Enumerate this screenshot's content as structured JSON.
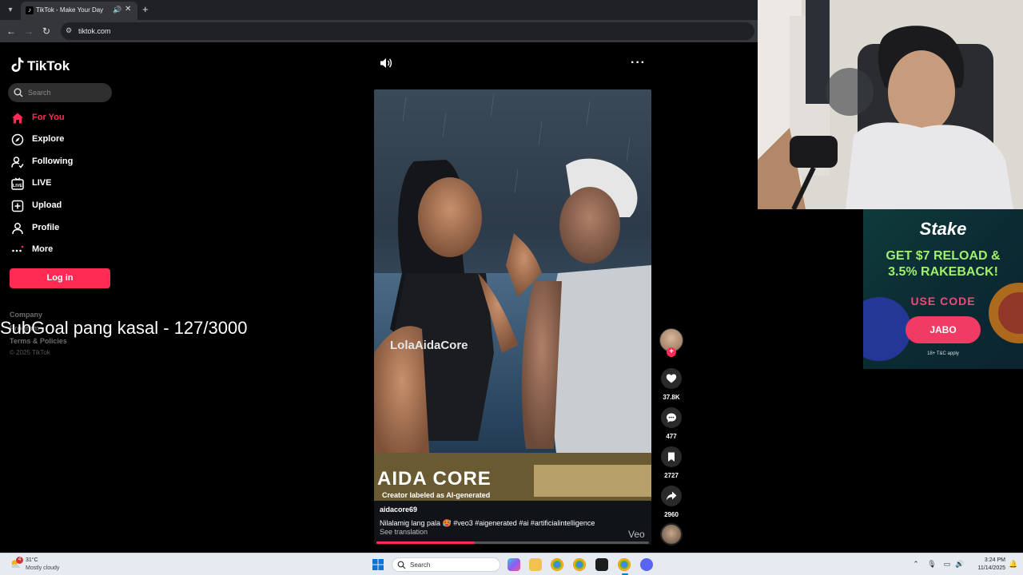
{
  "browser": {
    "tab_title": "TikTok - Make Your Day",
    "url": "tiktok.com"
  },
  "sidebar": {
    "logo_text": "TikTok",
    "search_placeholder": "Search",
    "nav": [
      {
        "label": "For You",
        "icon": "home-icon",
        "active": true
      },
      {
        "label": "Explore",
        "icon": "compass-icon"
      },
      {
        "label": "Following",
        "icon": "following-icon"
      },
      {
        "label": "LIVE",
        "icon": "live-icon"
      },
      {
        "label": "Upload",
        "icon": "upload-icon"
      },
      {
        "label": "Profile",
        "icon": "profile-icon"
      },
      {
        "label": "More",
        "icon": "more-icon"
      }
    ],
    "login_label": "Log in",
    "footer": {
      "company": "Company",
      "program": "Program",
      "terms": "Terms & Policies",
      "copyright": "© 2025 TikTok"
    }
  },
  "stream_overlay": {
    "text": "SubGoal pang kasal - 127/3000"
  },
  "video": {
    "watermark_title": "AIDA CORE",
    "ai_label": "Creator labeled as AI-generated",
    "shirt_text": "LolaAidaCore",
    "author": "aidacore69",
    "description": "Nilalamig lang pala 🥵 #veo3 #aigenerated #ai #artificialintelligence",
    "see_translation": "See translation",
    "veo_mark": "Veo",
    "progress": 0.36,
    "actions": {
      "likes": "37.8K",
      "comments": "477",
      "saves": "2727",
      "shares": "2960"
    }
  },
  "ad": {
    "brand": "Stake",
    "headline_line1": "GET $7 RELOAD &",
    "headline_line2": "3.5% RAKEBACK!",
    "use_code": "USE CODE",
    "code": "JABO",
    "terms": "18+  T&C apply"
  },
  "taskbar": {
    "weather_badge": "4",
    "temperature": "31°C",
    "condition": "Mostly cloudy",
    "search_placeholder": "Search",
    "time": "3:24 PM",
    "date": "11/14/2025"
  },
  "colors": {
    "accent": "#fe2c55",
    "ad_headline": "#9ff06a",
    "ad_code": "#f04a7a"
  }
}
